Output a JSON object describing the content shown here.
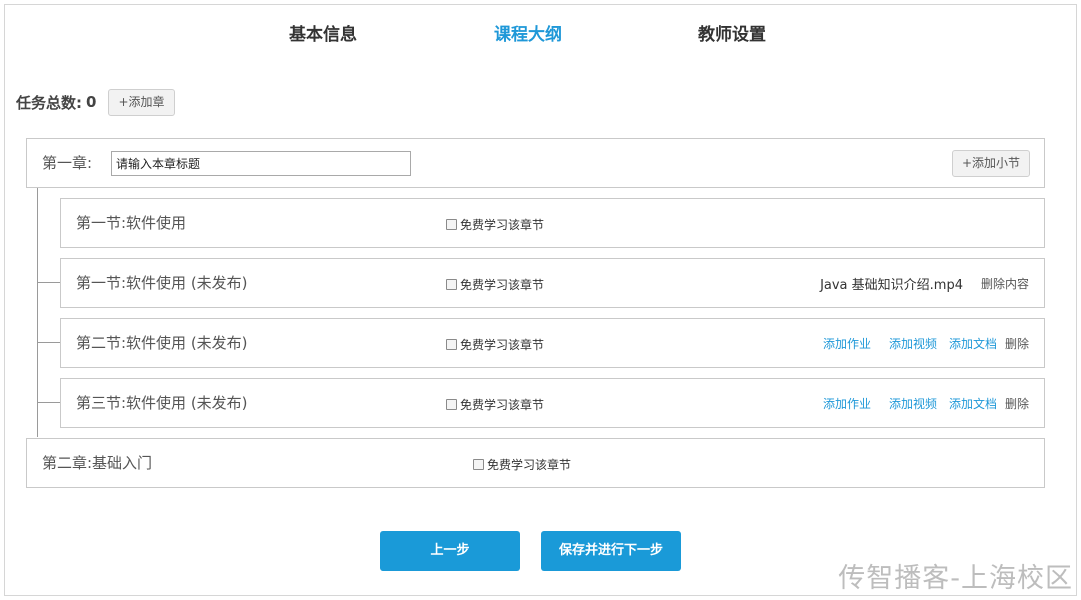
{
  "tabs": [
    {
      "label": "基本信息"
    },
    {
      "label": "课程大纲"
    },
    {
      "label": "教师设置"
    }
  ],
  "summary": {
    "label": "任务总数:",
    "count": "0",
    "add_chapter": "+添加章"
  },
  "free_label": "免费学习该章节",
  "chapter1": {
    "title": "第一章:",
    "input_value": "请输入本章标题",
    "add_section": "+添加小节"
  },
  "sections": [
    {
      "title": "第一节:软件使用"
    },
    {
      "title": "第一节:软件使用 (未发布)",
      "file": "Java 基础知识介绍.mp4",
      "delete_content": "删除内容"
    },
    {
      "title": "第二节:软件使用 (未发布)",
      "add_homework": "添加作业",
      "add_video": "添加视频",
      "add_doc": "添加文档",
      "delete": "删除"
    },
    {
      "title": "第三节:软件使用 (未发布)",
      "add_homework": "添加作业",
      "add_video": "添加视频",
      "add_doc": "添加文档",
      "delete": "删除"
    }
  ],
  "chapter2": {
    "title": "第二章:基础入门"
  },
  "buttons": {
    "prev": "上一步",
    "save_next": "保存并进行下一步"
  },
  "watermark": "传智播客-上海校区",
  "colors": {
    "accent": "#1f98d8",
    "button": "#1a9ad8"
  }
}
